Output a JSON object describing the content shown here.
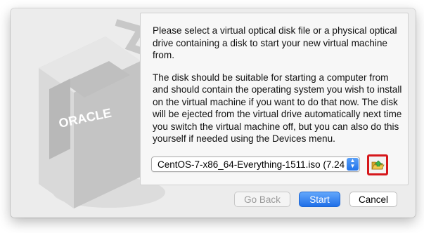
{
  "dialog": {
    "paragraphs": [
      "Please select a virtual optical disk file or a physical optical drive containing a disk to start your new virtual machine from.",
      "The disk should be suitable for starting a computer from and should contain the operating system you wish to install on the virtual machine if you want to do that now. The disk will be ejected from the virtual drive automatically next time you switch the virtual machine off, but you can also do this yourself if needed using the Devices menu."
    ],
    "disk_select": {
      "value": "CentOS-7-x86_64-Everything-1511.iso (7.24"
    },
    "art_logo_text": "ORACLE"
  },
  "buttons": {
    "back_label": "Go Back",
    "start_label": "Start",
    "cancel_label": "Cancel"
  },
  "colors": {
    "accent": "#2173ea",
    "highlight": "#d6171b",
    "dialog_bg": "#ececec"
  },
  "icons": {
    "choose_disk": "folder-open-icon",
    "select_arrows": "up-down-chevron-icon"
  }
}
